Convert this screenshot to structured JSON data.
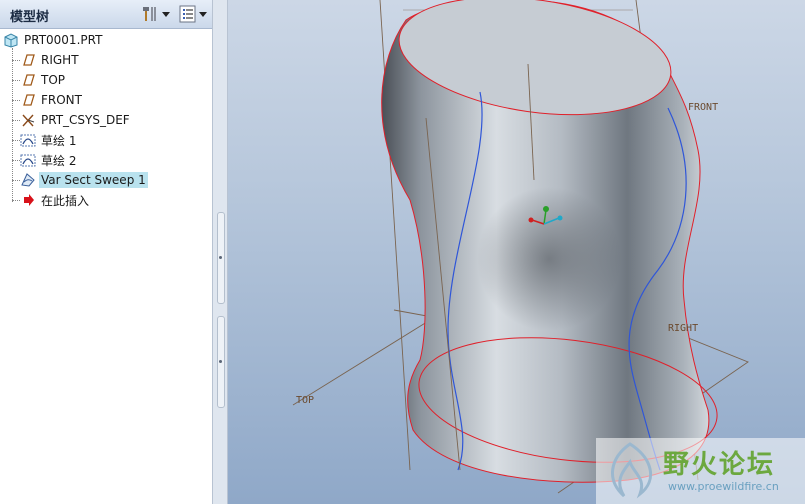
{
  "model_tree": {
    "title": "模型树",
    "root": "PRT0001.PRT",
    "items": [
      {
        "label": "RIGHT",
        "icon": "datum-plane-icon"
      },
      {
        "label": "TOP",
        "icon": "datum-plane-icon"
      },
      {
        "label": "FRONT",
        "icon": "datum-plane-icon"
      },
      {
        "label": "PRT_CSYS_DEF",
        "icon": "csys-icon"
      },
      {
        "label": "草绘 1",
        "icon": "sketch-icon"
      },
      {
        "label": "草绘 2",
        "icon": "sketch-icon"
      },
      {
        "label": "Var Sect Sweep 1",
        "icon": "sweep-icon",
        "selected": true
      },
      {
        "label": "在此插入",
        "icon": "insert-here-arrow-icon"
      }
    ]
  },
  "viewport": {
    "datum_labels": {
      "front": "FRONT",
      "right": "RIGHT",
      "top": "TOP"
    }
  },
  "watermark": {
    "text": "野火论坛",
    "url": "www.proewildfire.cn"
  },
  "colors": {
    "edge": "#e0202a",
    "datum": "#8a6a4a",
    "trajectory": "#2f56d8",
    "selection": "#b9e2ee"
  }
}
